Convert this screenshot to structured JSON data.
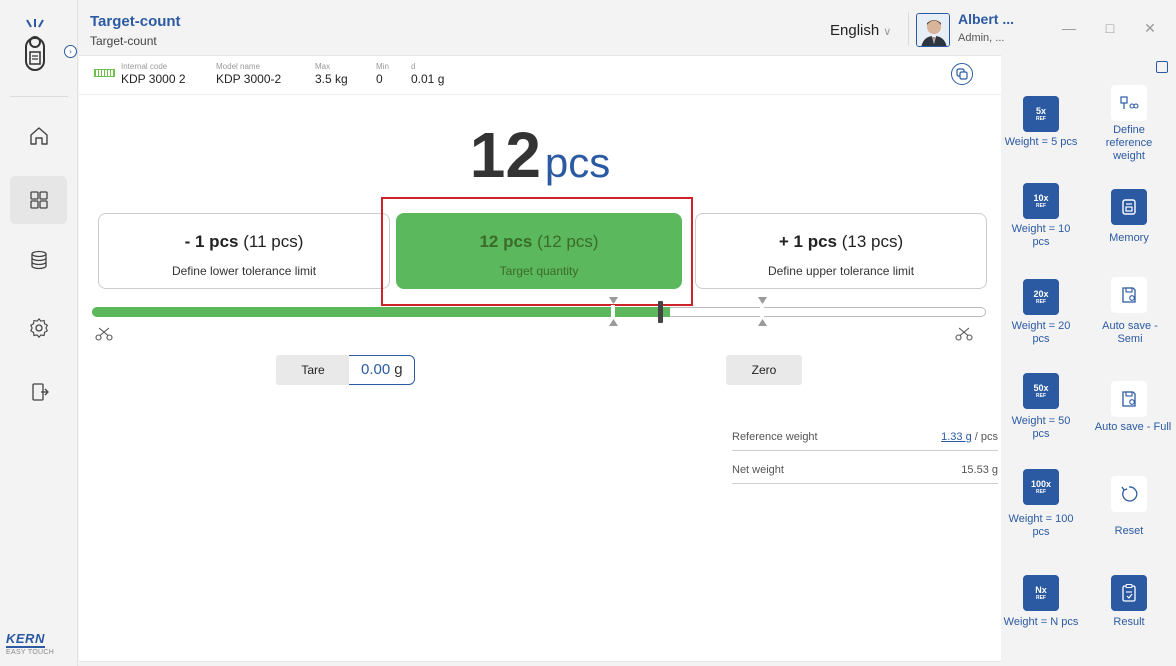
{
  "header": {
    "title": "Target-count",
    "subtitle": "Target-count",
    "language": "English",
    "user_name": "Albert ...",
    "user_role": "Admin, ..."
  },
  "brand": {
    "name": "KERN",
    "tagline": "EASY TOUCH"
  },
  "nav": {
    "items": [
      {
        "icon": "home-icon"
      },
      {
        "icon": "apps-grid-icon",
        "active": true
      },
      {
        "icon": "database-icon"
      },
      {
        "icon": "settings-gear-icon"
      },
      {
        "icon": "exit-door-icon"
      }
    ]
  },
  "device": {
    "internal_code_label": "Internal code",
    "internal_code": "KDP 3000 2",
    "model_label": "Model name",
    "model": "KDP 3000-2",
    "max_label": "Max",
    "max": "3.5 kg",
    "min_label": "Min",
    "min": "0",
    "d_label": "d",
    "d": "0.01 g"
  },
  "count": {
    "value": "12",
    "unit": "pcs"
  },
  "tolerance": {
    "lower": {
      "main": "- 1 pcs",
      "paren": "(11 pcs)",
      "label": "Define lower tolerance limit"
    },
    "target": {
      "main": "12 pcs",
      "paren": "(12 pcs)",
      "label": "Target quantity"
    },
    "upper": {
      "main": "+ 1 pcs",
      "paren": "(13 pcs)",
      "label": "Define upper tolerance limit"
    }
  },
  "controls": {
    "tare_label": "Tare",
    "tare_value": "0.00",
    "tare_unit": "g",
    "zero_label": "Zero"
  },
  "weights": {
    "reference_label": "Reference weight",
    "reference_value": "1.33 g",
    "reference_suffix": "/ pcs",
    "net_label": "Net weight",
    "net_value": "15.53",
    "net_unit": "g"
  },
  "right_panel": {
    "tiles": [
      {
        "badge": "5x",
        "sub": "REF",
        "label": "Weight = 5 pcs"
      },
      {
        "icon": "define-reference-icon",
        "label": "Define reference weight"
      },
      {
        "badge": "10x",
        "sub": "REF",
        "label": "Weight = 10 pcs"
      },
      {
        "icon": "memory-icon",
        "label": "Memory"
      },
      {
        "badge": "20x",
        "sub": "REF",
        "label": "Weight = 20 pcs"
      },
      {
        "icon": "auto-save-semi-icon",
        "label": "Auto save - Semi"
      },
      {
        "badge": "50x",
        "sub": "REF",
        "label": "Weight = 50 pcs"
      },
      {
        "icon": "auto-save-full-icon",
        "label": "Auto save - Full"
      },
      {
        "badge": "100x",
        "sub": "REF",
        "label": "Weight = 100 pcs"
      },
      {
        "icon": "reset-icon",
        "label": "Reset"
      },
      {
        "badge": "Nx",
        "sub": "REF",
        "label": "Weight = N pcs"
      },
      {
        "icon": "result-icon",
        "label": "Result"
      }
    ]
  },
  "colors": {
    "accent": "#2b5aa3",
    "ok_green": "#5cb85c",
    "highlight_red": "#cc2229"
  }
}
